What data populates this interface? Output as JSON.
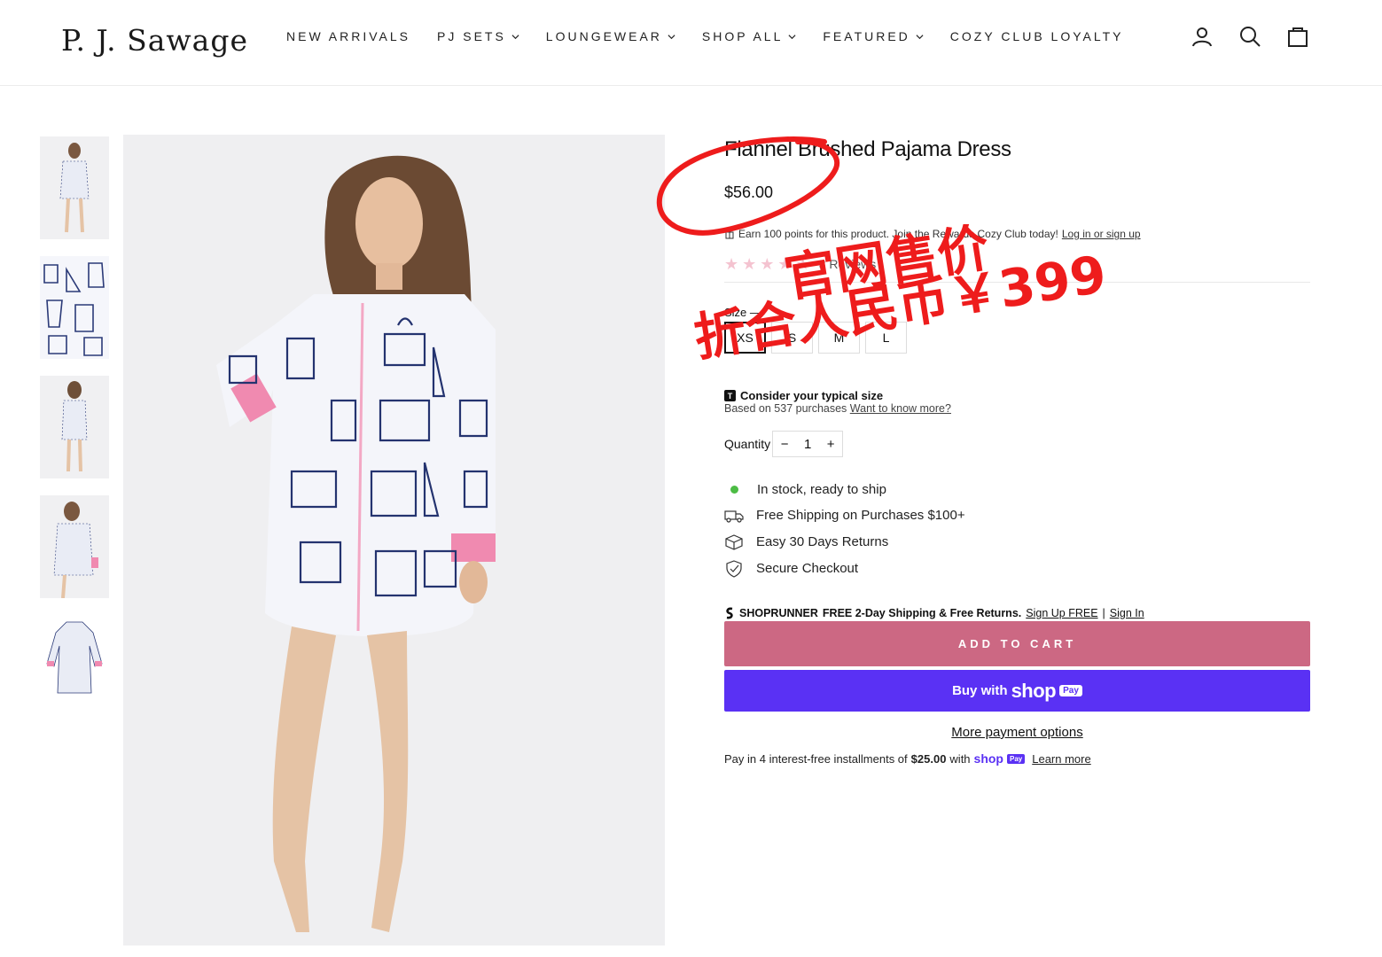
{
  "header": {
    "logo": "P. J. Sawage",
    "nav": [
      {
        "label": "NEW ARRIVALS",
        "dropdown": false
      },
      {
        "label": "PJ SETS",
        "dropdown": true
      },
      {
        "label": "LOUNGEWEAR",
        "dropdown": true
      },
      {
        "label": "SHOP ALL",
        "dropdown": true
      },
      {
        "label": "FEATURED",
        "dropdown": true
      },
      {
        "label": "COZY CLUB LOYALTY",
        "dropdown": false
      }
    ],
    "icons": [
      "account-icon",
      "search-icon",
      "cart-icon"
    ]
  },
  "gallery": {
    "thumbnail_count": 5,
    "active_index": 0
  },
  "product": {
    "title": "Flannel Brushed Pajama Dress",
    "price": "$56.00",
    "rewards_text": "Earn 100 points for this product. Join the Rewards Cozy Club today!",
    "rewards_link": "Log in or sign up",
    "rating": 5,
    "reviews_label": "3 Reviews",
    "size_label": "Size",
    "sizes": [
      "XS",
      "S",
      "M",
      "L"
    ],
    "selected_size": "XS",
    "fit_title": "Consider your typical size",
    "fit_sub": "Based on 537 purchases",
    "fit_link": "Want to know more?",
    "quantity_label": "Quantity",
    "quantity": "1",
    "qty_minus": "−",
    "qty_plus": "+",
    "stock": "In stock, ready to ship",
    "perks": [
      "Free Shipping on Purchases $100+",
      "Easy 30 Days Returns",
      "Secure Checkout"
    ],
    "shoprunner": {
      "brand": "SHOPRUNNER",
      "offer": "FREE 2-Day Shipping & Free Returns.",
      "signup": "Sign Up FREE",
      "separator": "|",
      "signin": "Sign In"
    },
    "add_to_cart": "ADD TO CART",
    "shop_pay": {
      "buy_with": "Buy with",
      "shop": "shop",
      "pay": "Pay"
    },
    "more_payment": "More payment options",
    "installments": {
      "prefix": "Pay in 4 interest-free installments of",
      "amount": "$25.00",
      "with": "with",
      "shop": "shop",
      "pay": "Pay",
      "learn_more": "Learn more"
    }
  },
  "annotation": {
    "line1": "官网售价",
    "line2": "折合人民币￥399",
    "color": "#ee1c1c"
  },
  "colors": {
    "add_to_cart": "#cc6883",
    "shop_pay": "#5a31f4",
    "stock_dot": "#4cbc44",
    "star": "#f4c3d0"
  }
}
